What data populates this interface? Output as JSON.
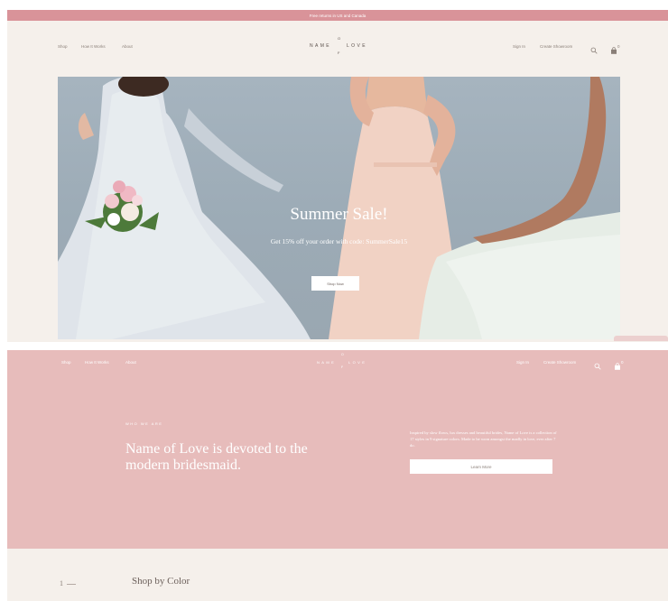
{
  "announcement": "Free returns in US and Canada",
  "nav": {
    "left": [
      "Shop",
      "How It Works",
      "About"
    ],
    "logo": {
      "word_left": "NAME",
      "word_right": "LOVE",
      "top": "O",
      "bottom": "F"
    },
    "sign_in": "Sign In",
    "create_showroom": "Create Showroom",
    "cart_count": "0",
    "icons": {
      "search": "search-icon",
      "cart": "shopping-bag-icon"
    }
  },
  "hero": {
    "title": "Summer Sale!",
    "subtitle": "Get 15% off your order with code: SummerSale15",
    "button": "Shop Now"
  },
  "about": {
    "eyebrow": "WHO WE ARE",
    "headline": "Name of Love is devoted to the modern bridesmaid.",
    "paragraph": "Inspired by slow flows, lux dresses and beautiful brides, Name of Love is a collection of 17 styles in 9 signature colors. Made to be worn amongst the madly in love, ever after 7 do.",
    "button": "Learn More"
  },
  "section": {
    "number": "1",
    "title": "Shop by Color"
  },
  "colors": {
    "announce_bar": "#d99399",
    "cream": "#f5f0eb",
    "pink_section": "#e7bcbb",
    "hero_bg": "#a6b4bf"
  }
}
